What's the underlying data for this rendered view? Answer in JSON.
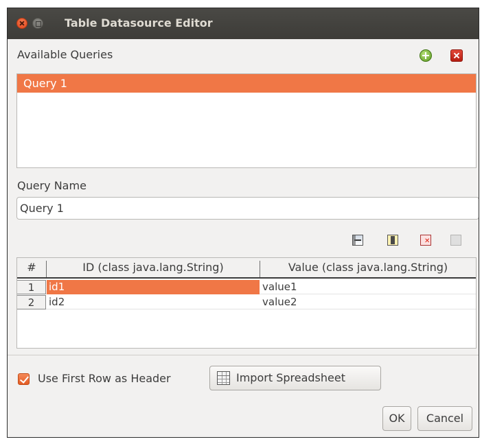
{
  "window": {
    "title": "Table Datasource Editor"
  },
  "queries": {
    "label": "Available Queries",
    "add_icon": "plus-circle-icon",
    "remove_icon": "remove-icon",
    "items": [
      "Query 1"
    ],
    "selected_index": 0
  },
  "query_name": {
    "label": "Query Name",
    "value": "Query 1"
  },
  "toolbar": {
    "icons": [
      "add-row-icon",
      "add-column-icon",
      "remove-row-icon",
      "remove-column-icon"
    ]
  },
  "table": {
    "headers": [
      "#",
      "ID (class java.lang.String)",
      "Value (class java.lang.String)"
    ],
    "rows": [
      {
        "num": "1",
        "id": "id1",
        "value": "value1"
      },
      {
        "num": "2",
        "id": "id2",
        "value": "value2"
      }
    ],
    "selected_row": 0,
    "selected_column": 1
  },
  "options": {
    "use_first_row_label": "Use First Row as Header",
    "use_first_row_checked": true,
    "import_label": "Import Spreadsheet"
  },
  "actions": {
    "ok_label": "OK",
    "cancel_label": "Cancel"
  },
  "colors": {
    "accent": "#f07746",
    "titlebar": "#3d3c38",
    "background": "#f2f1f0"
  }
}
